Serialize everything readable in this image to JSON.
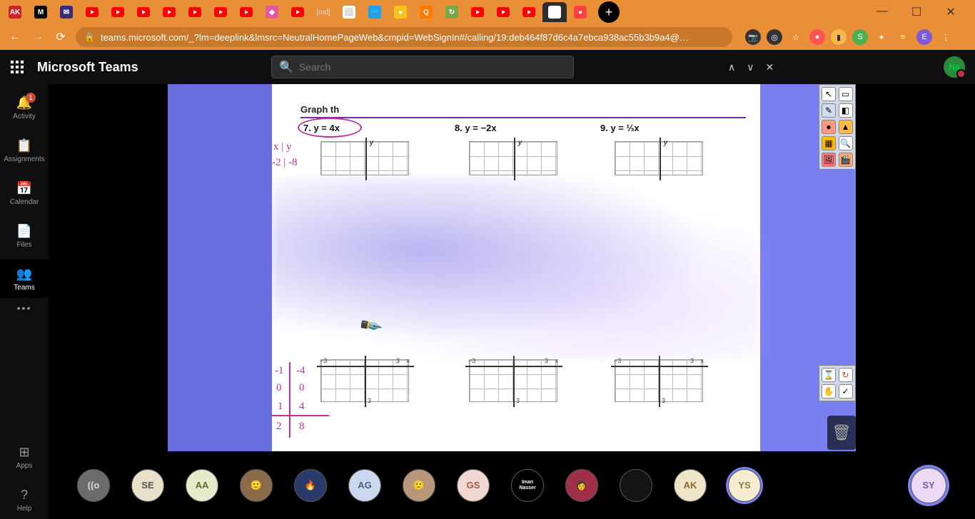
{
  "browser": {
    "tabs": [
      {
        "type": "icon",
        "color": "#c62828",
        "label": "AK"
      },
      {
        "type": "icon",
        "color": "#000",
        "label": "M"
      },
      {
        "type": "icon",
        "color": "#3a2a7a",
        "label": "✉"
      },
      {
        "type": "yt"
      },
      {
        "type": "yt"
      },
      {
        "type": "yt"
      },
      {
        "type": "yt"
      },
      {
        "type": "yt"
      },
      {
        "type": "yt"
      },
      {
        "type": "yt"
      },
      {
        "type": "icon",
        "color": "#e05aa0",
        "label": "◆"
      },
      {
        "type": "yt"
      },
      {
        "type": "text",
        "label": "[md]"
      },
      {
        "type": "icon",
        "color": "#fff",
        "label": "⬜"
      },
      {
        "type": "icon",
        "color": "#1da1f2",
        "label": "🐦"
      },
      {
        "type": "icon",
        "color": "#f5c518",
        "label": "●"
      },
      {
        "type": "icon",
        "color": "#ff7a00",
        "label": "Q"
      },
      {
        "type": "icon",
        "color": "#7a4",
        "label": "↻"
      },
      {
        "type": "yt"
      },
      {
        "type": "yt"
      },
      {
        "type": "yt"
      },
      {
        "type": "icon",
        "color": "#fff",
        "label": "⊞",
        "active": true
      },
      {
        "type": "icon",
        "color": "#ff4040",
        "label": "●"
      }
    ],
    "url": "teams.microsoft.com/_?lm=deeplink&lmsrc=NeutralHomePageWeb&cmpid=WebSignIn#/calling/19:deb464f87d6c4a7ebca938ac55b3b9a4@…",
    "extensions": [
      {
        "bg": "#333",
        "fg": "#fff",
        "t": "📷"
      },
      {
        "bg": "#333",
        "fg": "#fff",
        "t": "◎"
      },
      {
        "bg": "transparent",
        "fg": "#fff",
        "t": "☆"
      },
      {
        "bg": "#ff5252",
        "fg": "#fff",
        "t": "●"
      },
      {
        "bg": "#ffb74d",
        "fg": "#333",
        "t": "▮"
      },
      {
        "bg": "#4caf50",
        "fg": "#fff",
        "t": "S"
      },
      {
        "bg": "transparent",
        "fg": "#fff",
        "t": "✦"
      },
      {
        "bg": "transparent",
        "fg": "#fff",
        "t": "≡"
      },
      {
        "bg": "#7b5bd6",
        "fg": "#fff",
        "t": "E"
      },
      {
        "bg": "transparent",
        "fg": "#fff",
        "t": "⋮"
      }
    ]
  },
  "teams": {
    "title": "Microsoft Teams",
    "search_placeholder": "Search",
    "me_initials": "Na",
    "rail": [
      {
        "icon": "🔔",
        "label": "Activity",
        "badge": "1"
      },
      {
        "icon": "📋",
        "label": "Assignments"
      },
      {
        "icon": "📅",
        "label": "Calendar"
      },
      {
        "icon": "📄",
        "label": "Files"
      },
      {
        "icon": "👥",
        "label": "Teams",
        "active": true
      }
    ],
    "rail_bottom": [
      {
        "icon": "⊞",
        "label": "Apps"
      },
      {
        "icon": "?",
        "label": "Help"
      }
    ]
  },
  "worksheet": {
    "heading": "Graph th",
    "p7": "7.   y = 4x",
    "p8": "8.   y = −2x",
    "p9": "9.   y = ⅓x",
    "axis_y": "y",
    "tick_n3": "−3",
    "tick_3": "3",
    "tick_x": "x",
    "tick_b3": "3",
    "ann_xy": "x | y",
    "ann_row1": "-2 | -8",
    "ann_n1": "-1",
    "ann_n4": "-4",
    "ann_0a": "0",
    "ann_0b": "0",
    "ann_1": "1",
    "ann_4": "4",
    "ann_2": "2",
    "ann_8": "8"
  },
  "participants": [
    {
      "bg": "#6b6b6b",
      "fg": "#ddd",
      "t": "((o"
    },
    {
      "bg": "#e8e0c8",
      "fg": "#555",
      "t": "SE"
    },
    {
      "bg": "#e8eacc",
      "fg": "#5a6b2a",
      "t": "AA"
    },
    {
      "bg": "#8a6b4a",
      "fg": "#fff",
      "t": "🙂"
    },
    {
      "bg": "#2a3a6a",
      "fg": "#fff",
      "t": "🔥"
    },
    {
      "bg": "#cbd9ee",
      "fg": "#44628a",
      "t": "AG"
    },
    {
      "bg": "#b89878",
      "fg": "#fff",
      "t": "🙂"
    },
    {
      "bg": "#f0d8d0",
      "fg": "#9a5a4a",
      "t": "GS"
    },
    {
      "bg": "#000",
      "fg": "#fff",
      "t": "Iman",
      "iman": true
    },
    {
      "bg": "#a03048",
      "fg": "#fff",
      "t": "👩"
    },
    {
      "bg": "#141414",
      "fg": "#000",
      "t": ""
    },
    {
      "bg": "#f0e4c8",
      "fg": "#8a6a2a",
      "t": "AK"
    },
    {
      "bg": "#f5ecd2",
      "fg": "#8a7a3a",
      "t": "YS",
      "ring": true
    }
  ],
  "me_participant": {
    "bg": "#ecd9f5",
    "fg": "#7a5a9a",
    "t": "SY"
  }
}
